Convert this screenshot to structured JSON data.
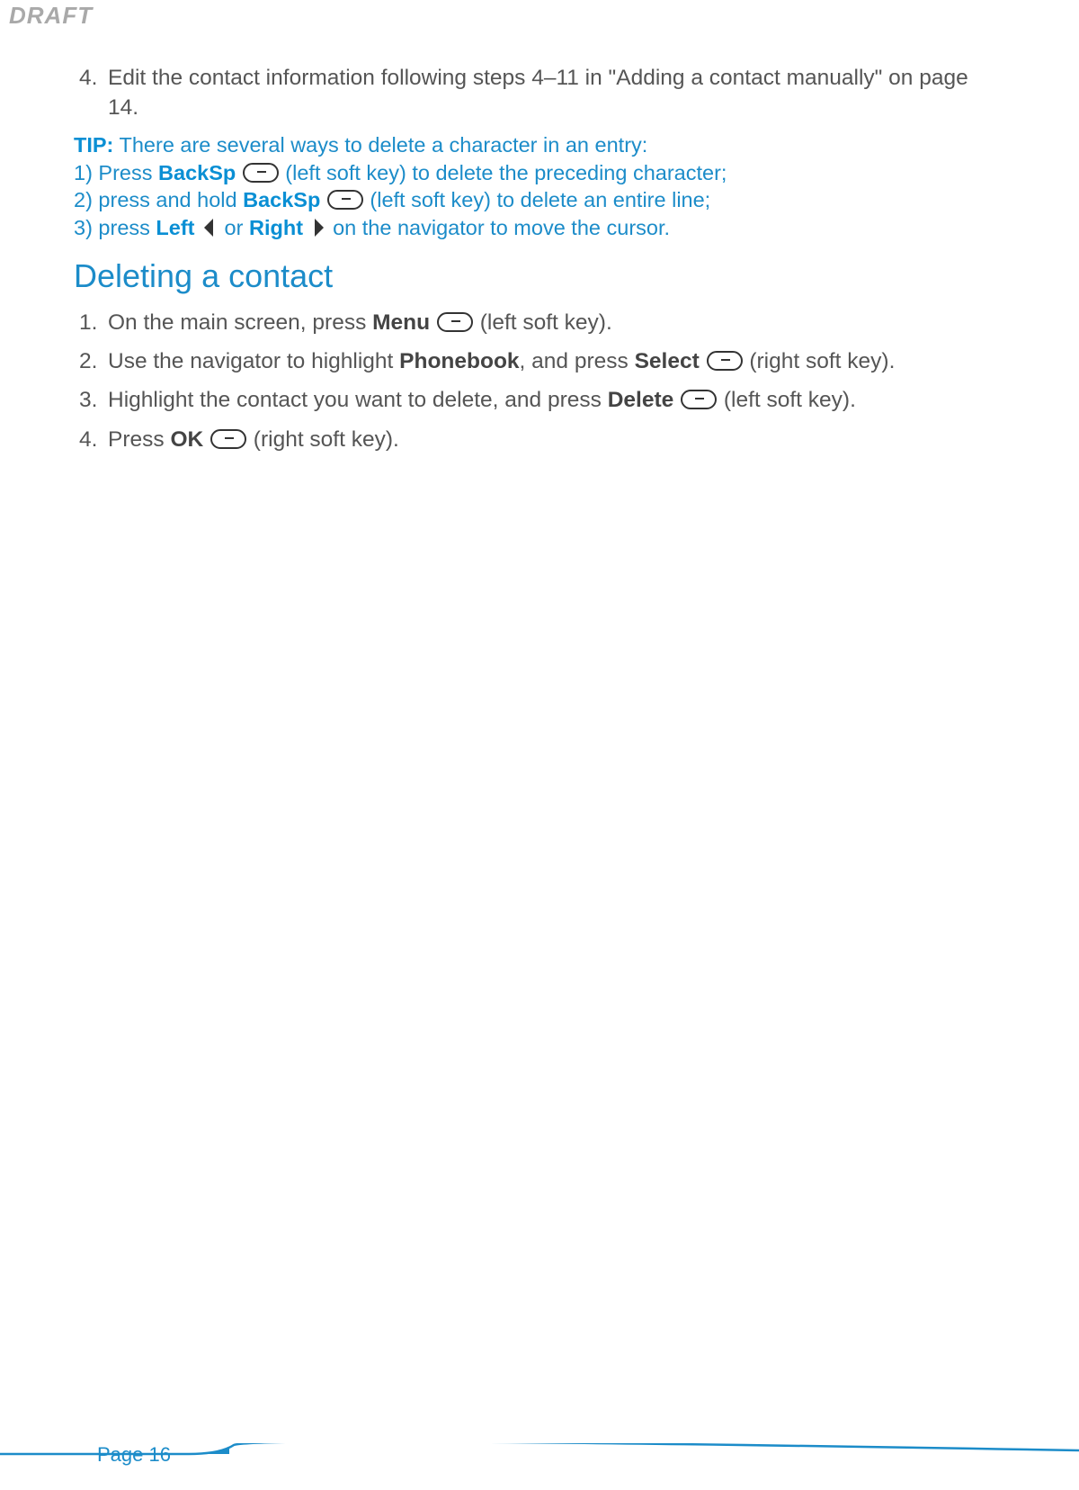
{
  "watermark": "DRAFT",
  "step4": {
    "num": "4.",
    "text": "Edit the contact information following steps 4–11 in \"Adding a contact manually\" on page 14."
  },
  "tip": {
    "label": "TIP:",
    "intro": " There are several ways to delete a character in an entry:",
    "line1a": "1) Press ",
    "backsp1": "BackSp",
    "line1b": " (left soft key) to delete the preceding character;",
    "line2a": "2) press and hold ",
    "backsp2": "BackSp",
    "line2b": " (left soft key) to delete an entire line;",
    "line3a": "3) press ",
    "left": "Left",
    "line3b": " or ",
    "right": "Right",
    "line3c": " on the navigator to move the cursor."
  },
  "heading": "Deleting a contact",
  "del1": {
    "num": "1.",
    "a": "On the main screen, press ",
    "menu": "Menu",
    "b": " (left soft key)."
  },
  "del2": {
    "num": "2.",
    "a": "Use the navigator to highlight ",
    "phonebook": "Phonebook",
    "b": ", and press ",
    "select": "Select",
    "c": " (right soft key)."
  },
  "del3": {
    "num": "3.",
    "a": "Highlight the contact you want to delete, and press ",
    "delete": "Delete",
    "b": " (left soft key)."
  },
  "del4": {
    "num": "4.",
    "a": "Press ",
    "ok": "OK",
    "b": " (right soft key)."
  },
  "footer": "Page 16"
}
